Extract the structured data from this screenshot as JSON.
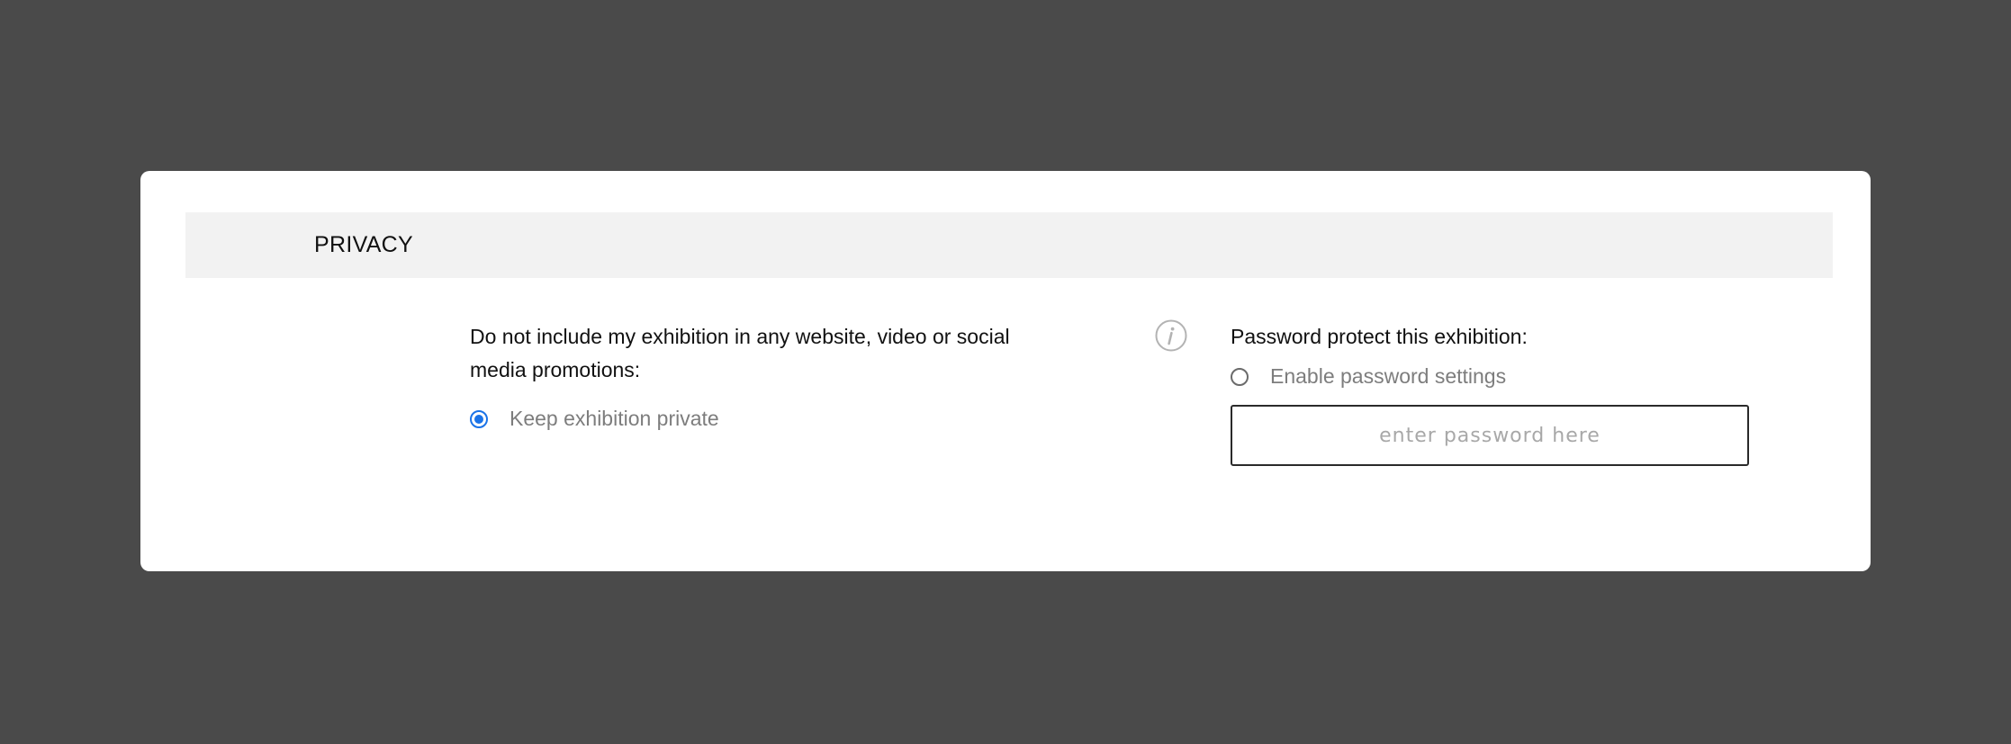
{
  "privacy": {
    "section_title": "PRIVACY",
    "promotions": {
      "prompt": "Do not include my exhibition in any website, video or social media promotions:",
      "option_label": "Keep exhibition private",
      "checked": true
    },
    "password": {
      "prompt": "Password protect this exhibition:",
      "option_label": "Enable password settings",
      "checked": false,
      "input_value": "",
      "input_placeholder": "enter password here"
    }
  },
  "icons": {
    "info": "info-icon"
  },
  "colors": {
    "background": "#4a4a4a",
    "card": "#ffffff",
    "header_band": "#f2f2f2",
    "radio_accent": "#1a73e8",
    "muted_text": "#7d7d7d"
  }
}
